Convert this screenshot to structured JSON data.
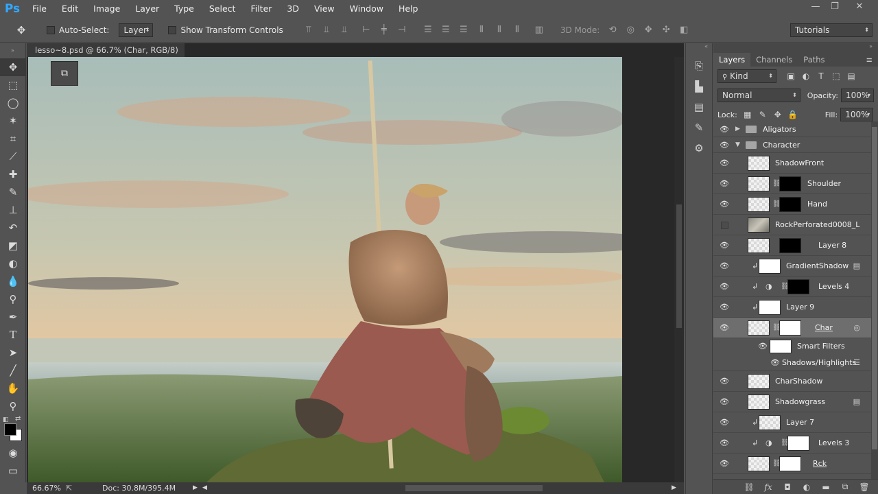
{
  "app": {
    "logo": "Ps"
  },
  "menu": [
    "File",
    "Edit",
    "Image",
    "Layer",
    "Type",
    "Select",
    "Filter",
    "3D",
    "View",
    "Window",
    "Help"
  ],
  "window_controls": {
    "minimize": "—",
    "restore": "❐",
    "close": "✕"
  },
  "options_bar": {
    "auto_select_label": "Auto-Select:",
    "auto_select_target": "Layer",
    "show_transform_label": "Show Transform Controls",
    "mode_3d_label": "3D Mode:",
    "workspace": "Tutorials"
  },
  "document": {
    "tab_title": "lesso~8.psd @ 66.7% (Char, RGB/8) *",
    "zoom": "66.67%",
    "doc_size": "Doc: 30.8M/395.4M"
  },
  "layers_panel": {
    "tabs": [
      "Layers",
      "Channels",
      "Paths"
    ],
    "active_tab": "Layers",
    "filter_kind": "Kind",
    "blend_mode": "Normal",
    "opacity_label": "Opacity:",
    "opacity_value": "100%",
    "lock_label": "Lock:",
    "fill_label": "Fill:",
    "fill_value": "100%",
    "layers": [
      {
        "name": "Aligators",
        "type": "group",
        "expanded": false,
        "visible": true
      },
      {
        "name": "Character",
        "type": "group",
        "expanded": true,
        "visible": true
      },
      {
        "name": "ShadowFront",
        "visible": true
      },
      {
        "name": "Shoulder",
        "visible": true,
        "mask": true
      },
      {
        "name": "Hand",
        "visible": true,
        "mask": true
      },
      {
        "name": "RockPerforated0008_L",
        "visible": false,
        "smart": true
      },
      {
        "name": "Layer 8",
        "visible": true,
        "mask": true
      },
      {
        "name": "GradientShadow",
        "visible": true,
        "clipped": true
      },
      {
        "name": "Levels 4",
        "visible": true,
        "clipped": true,
        "adjustment": true
      },
      {
        "name": "Layer 9",
        "visible": true,
        "clipped": true
      },
      {
        "name": "Char",
        "visible": true,
        "selected": true,
        "smart": true,
        "mask": true
      },
      {
        "name": "Smart Filters",
        "sub": true
      },
      {
        "name": "Shadows/Highlights",
        "sub": true,
        "filter": true
      },
      {
        "name": "CharShadow",
        "visible": true
      },
      {
        "name": "Shadowgrass",
        "visible": true
      },
      {
        "name": "Layer 7",
        "visible": true,
        "clipped": true
      },
      {
        "name": "Levels 3",
        "visible": true,
        "clipped": true,
        "adjustment": true
      },
      {
        "name": "Rck",
        "visible": true,
        "smart": true,
        "mask": true
      }
    ]
  },
  "icons": {
    "move_tool": "move-icon",
    "eye": "eye-icon",
    "link": "link-icon",
    "folder": "folder-icon"
  }
}
